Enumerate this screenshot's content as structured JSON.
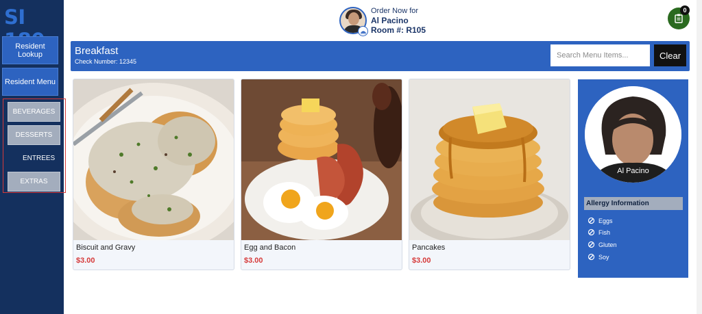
{
  "app": {
    "logo": "SI 180"
  },
  "nav": {
    "lookup_label": "Resident Lookup",
    "menu_label": "Resident Menu"
  },
  "categories": [
    {
      "label": "BEVERAGES",
      "selected": false
    },
    {
      "label": "DESSERTS",
      "selected": false
    },
    {
      "label": "ENTREES",
      "selected": true
    },
    {
      "label": "EXTRAS",
      "selected": false
    }
  ],
  "header": {
    "order_now": "Order Now for",
    "resident_name": "Al Pacino",
    "room": "Room #: R105"
  },
  "cart": {
    "count": "0",
    "icon": "clipboard-icon"
  },
  "menu_bar": {
    "title": "Breakfast",
    "check_number": "Check Number: 12345",
    "search_placeholder": "Search Menu Items...",
    "clear_label": "Clear"
  },
  "items": [
    {
      "name": "Biscuit and Gravy",
      "price": "$3.00"
    },
    {
      "name": "Egg and Bacon",
      "price": "$3.00"
    },
    {
      "name": "Pancakes",
      "price": "$3.00"
    }
  ],
  "profile": {
    "name": "Al Pacino",
    "allergy_title": "Allergy Information",
    "allergies": [
      "Eggs",
      "Fish",
      "Gluten",
      "Soy"
    ]
  },
  "colors": {
    "primary": "#2d63c0",
    "sidebar": "#14305e",
    "price": "#d63a3a",
    "cart": "#2a6a1f",
    "highlight_border": "#d63a3a"
  }
}
